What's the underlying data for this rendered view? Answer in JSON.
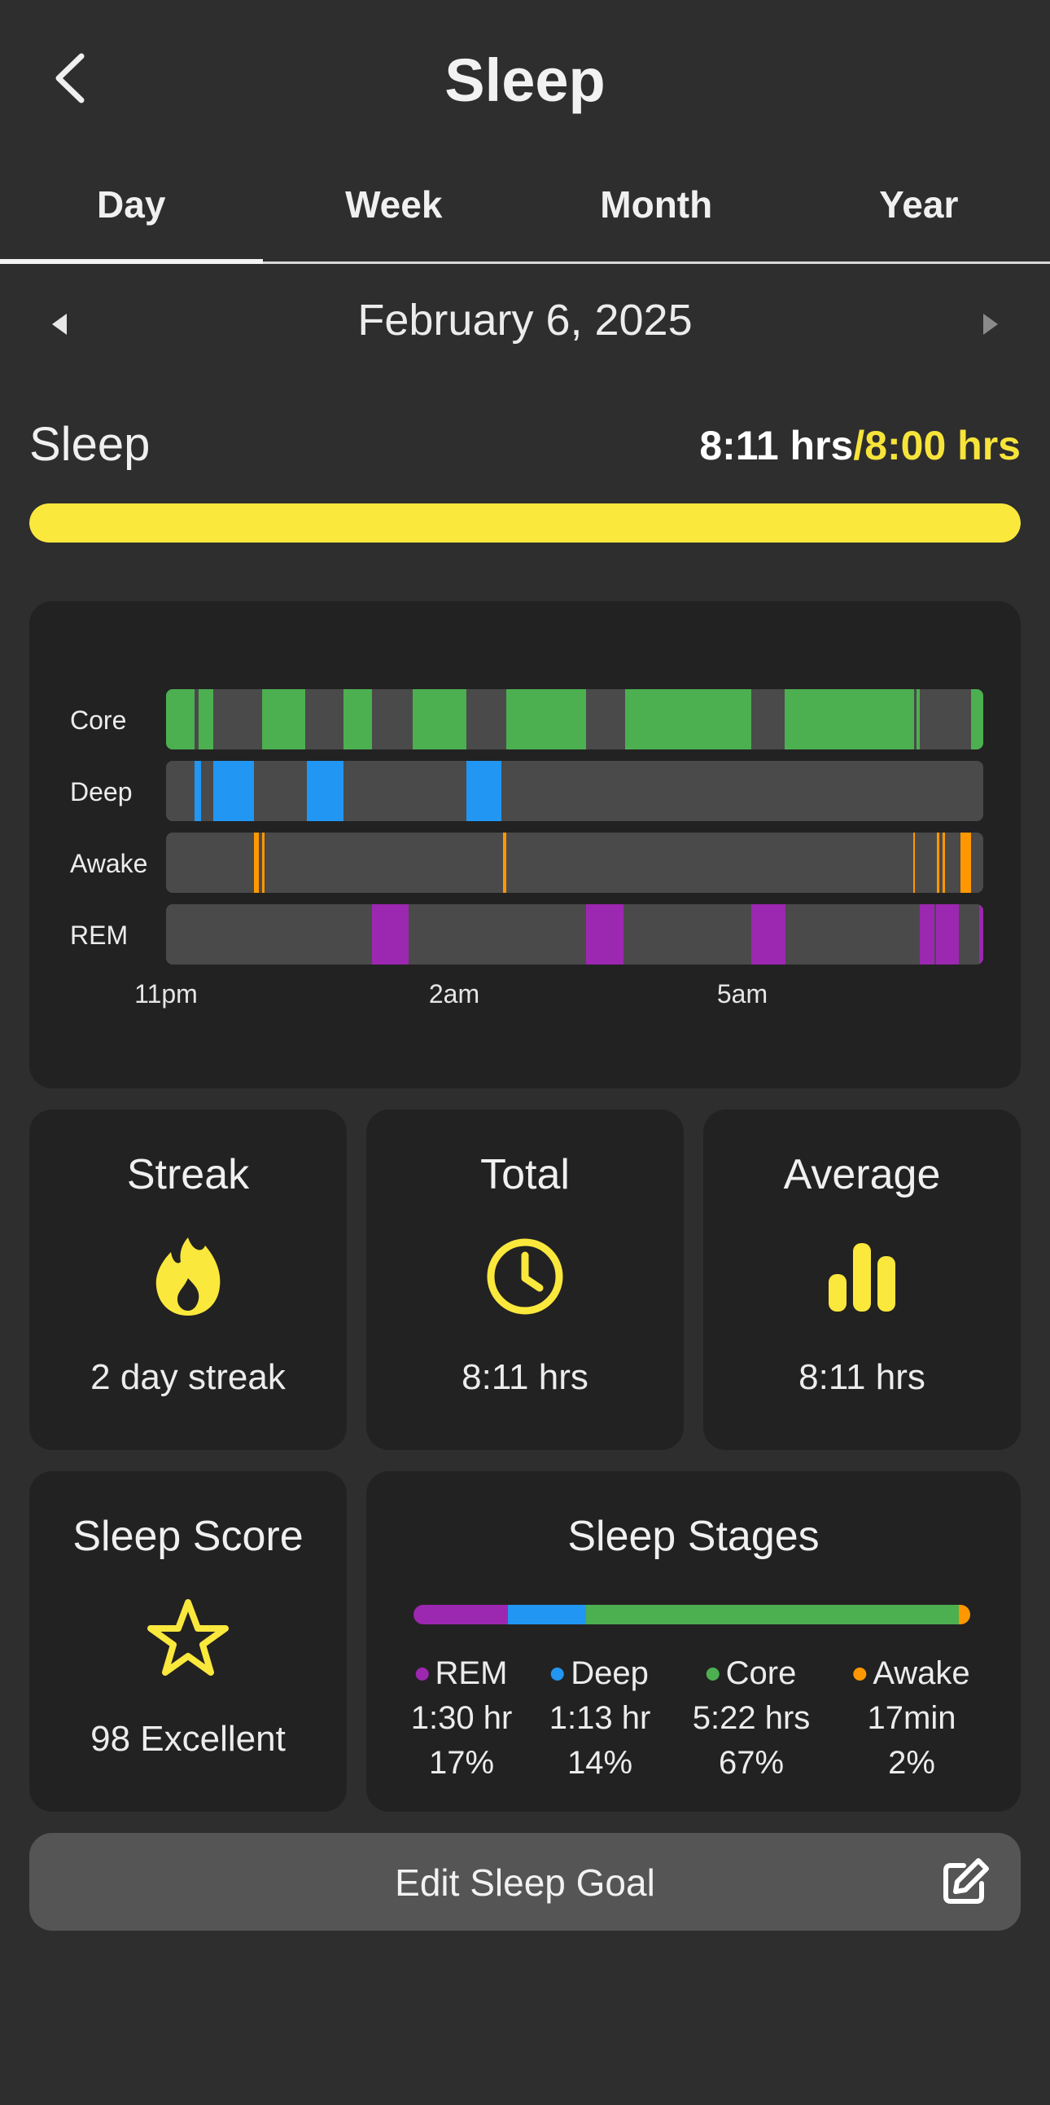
{
  "header": {
    "title": "Sleep",
    "back_icon": "chevron-left-icon"
  },
  "tabs": [
    {
      "label": "Day",
      "active": true
    },
    {
      "label": "Week",
      "active": false
    },
    {
      "label": "Month",
      "active": false
    },
    {
      "label": "Year",
      "active": false
    }
  ],
  "date_nav": {
    "label": "February 6, 2025",
    "prev_icon": "triangle-left-icon",
    "next_icon": "triangle-right-icon"
  },
  "summary": {
    "label": "Sleep",
    "actual": "8:11 hrs",
    "goal": "/8:00 hrs",
    "progress_fraction": 1.0
  },
  "colors": {
    "core": "#4caf50",
    "deep": "#2196f3",
    "awake": "#ff9800",
    "rem": "#9c27b0",
    "accent": "#fbe83c",
    "track": "#4a4a4a"
  },
  "hypnogram": {
    "stages": [
      {
        "key": "core",
        "label": "Core"
      },
      {
        "key": "deep",
        "label": "Deep"
      },
      {
        "key": "awake",
        "label": "Awake"
      },
      {
        "key": "rem",
        "label": "REM"
      }
    ],
    "x_ticks": [
      "11pm",
      "2am",
      "5am"
    ],
    "segments": {
      "core": [
        [
          0.0,
          0.035
        ],
        [
          0.04,
          0.058
        ],
        [
          0.118,
          0.17
        ],
        [
          0.217,
          0.252
        ],
        [
          0.302,
          0.368
        ],
        [
          0.416,
          0.514
        ],
        [
          0.562,
          0.635
        ],
        [
          0.635,
          0.716
        ],
        [
          0.757,
          0.915
        ],
        [
          0.918,
          0.922
        ],
        [
          0.985,
          1.0
        ]
      ],
      "deep": [
        [
          0.035,
          0.043
        ],
        [
          0.058,
          0.108
        ],
        [
          0.172,
          0.217
        ],
        [
          0.368,
          0.41
        ]
      ],
      "awake": [
        [
          0.108,
          0.114
        ],
        [
          0.118,
          0.121
        ],
        [
          0.412,
          0.416
        ],
        [
          0.914,
          0.916
        ],
        [
          0.943,
          0.946
        ],
        [
          0.95,
          0.953
        ],
        [
          0.972,
          0.985
        ]
      ],
      "rem": [
        [
          0.252,
          0.297
        ],
        [
          0.514,
          0.56
        ],
        [
          0.716,
          0.758
        ],
        [
          0.922,
          0.94
        ],
        [
          0.942,
          0.97
        ],
        [
          0.995,
          1.0
        ]
      ]
    }
  },
  "stats": {
    "streak": {
      "title": "Streak",
      "value": "2 day streak",
      "icon": "flame-icon"
    },
    "total": {
      "title": "Total",
      "value": "8:11 hrs",
      "icon": "clock-icon"
    },
    "average": {
      "title": "Average",
      "value": "8:11 hrs",
      "icon": "bar-chart-icon"
    }
  },
  "score": {
    "title": "Sleep Score",
    "value": "98 Excellent",
    "icon": "star-icon"
  },
  "stages_summary": {
    "title": "Sleep Stages",
    "items": [
      {
        "key": "rem",
        "name": "REM",
        "duration": "1:30 hr",
        "percent": "17%",
        "fraction": 0.17
      },
      {
        "key": "deep",
        "name": "Deep",
        "duration": "1:13 hr",
        "percent": "14%",
        "fraction": 0.14
      },
      {
        "key": "core",
        "name": "Core",
        "duration": "5:22 hrs",
        "percent": "67%",
        "fraction": 0.67
      },
      {
        "key": "awake",
        "name": "Awake",
        "duration": "17min",
        "percent": "2%",
        "fraction": 0.02
      }
    ]
  },
  "edit_goal": {
    "label": "Edit Sleep Goal",
    "icon": "edit-icon"
  }
}
